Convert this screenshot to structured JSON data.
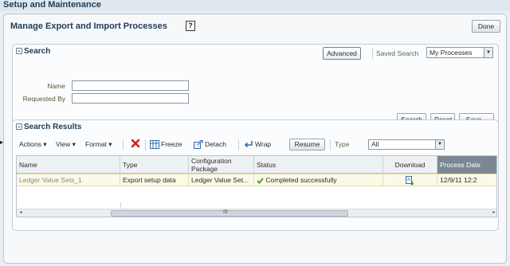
{
  "app": {
    "title": "Setup and Maintenance"
  },
  "page": {
    "title": "Manage Export and Import Processes",
    "help_glyph": "?",
    "done_label": "Done"
  },
  "search": {
    "header": "Search",
    "advanced_label": "Advanced",
    "saved_search_label": "Saved Search",
    "saved_search_value": "My Processes",
    "fields": {
      "name_label": "Name",
      "name_value": "",
      "requested_by_label": "Requested By",
      "requested_by_value": ""
    },
    "buttons": {
      "search": "Search",
      "reset": "Reset",
      "save": "Save..."
    }
  },
  "results": {
    "header": "Search Results",
    "toolbar": {
      "actions": "Actions",
      "view": "View",
      "format": "Format",
      "freeze": "Freeze",
      "detach": "Detach",
      "wrap": "Wrap",
      "resume": "Resume",
      "type_label": "Type",
      "type_value": "All"
    },
    "columns": [
      "Name",
      "Type",
      "Configuration Package",
      "Status",
      "Download",
      "Process Date"
    ],
    "rows": [
      {
        "name": "Ledger Value Sets_1",
        "type": "Export setup data",
        "package": "Ledger Value Set...",
        "status": "Completed successfully",
        "process_date": "12/9/11 12:2"
      }
    ],
    "scroll_glyph": "III"
  },
  "colors": {
    "accent": "#1f3b57",
    "selected_row": "#fcf9e7",
    "success": "#3a9a2a",
    "delete": "#d42020"
  },
  "icons": [
    "collapse-icon",
    "help-icon",
    "delete-icon",
    "freeze-icon",
    "detach-icon",
    "wrap-icon",
    "check-icon",
    "download-icon",
    "dropdown-arrow-icon"
  ]
}
